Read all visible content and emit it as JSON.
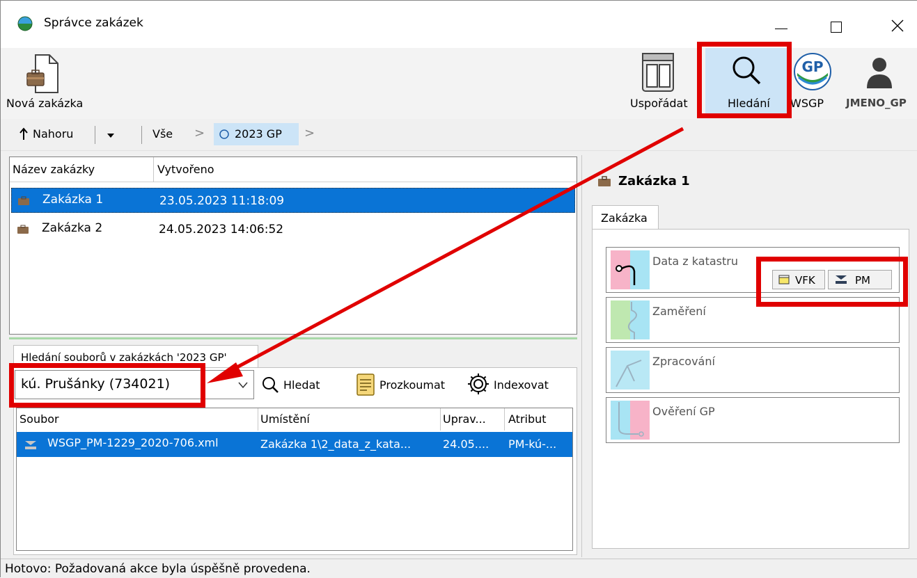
{
  "window": {
    "title": "Správce zakázek"
  },
  "toolbar": {
    "new_order": "Nová zakázka",
    "arrange": "Uspořádat",
    "search": "Hledání",
    "wsgp": "WSGP",
    "user": "JMENO_GP"
  },
  "navbar": {
    "up": "Nahoru",
    "all": "Vše",
    "current": "2023 GP"
  },
  "orders_table": {
    "columns": [
      "Název zakázky",
      "Vytvořeno"
    ],
    "rows": [
      {
        "name": "Zakázka 1",
        "created": "23.05.2023 11:18:09"
      },
      {
        "name": "Zakázka 2",
        "created": "24.05.2023 14:06:52"
      }
    ]
  },
  "file_search": {
    "tab_label": "Hledání souborů v zakázkách '2023 GP'",
    "query": "kú. Prušánky (734021)",
    "search_btn": "Hledat",
    "explore_btn": "Prozkoumat",
    "index_btn": "Indexovat",
    "columns": [
      "Soubor",
      "Umístění",
      "Uprav...",
      "Atribut"
    ],
    "rows": [
      {
        "file": "WSGP_PM-1229_2020-706.xml",
        "location": "Zakázka 1\\2_data_z_kata...",
        "modified": "24.05....",
        "attribute": "PM-kú-..."
      }
    ]
  },
  "detail": {
    "title": "Zakázka 1",
    "tab": "Zakázka",
    "cards": [
      {
        "label": "Data z katastru"
      },
      {
        "label": "Zaměření"
      },
      {
        "label": "Zpracování"
      },
      {
        "label": "Ověření GP"
      }
    ],
    "vfk_btn": "VFK",
    "pm_btn": "PM"
  },
  "status": {
    "text": "Hotovo: Požadovaná akce byla úspěšně provedena."
  },
  "colors": {
    "selection": "#0a74d6",
    "highlight": "#e00000",
    "search_active": "#cce4f7"
  }
}
